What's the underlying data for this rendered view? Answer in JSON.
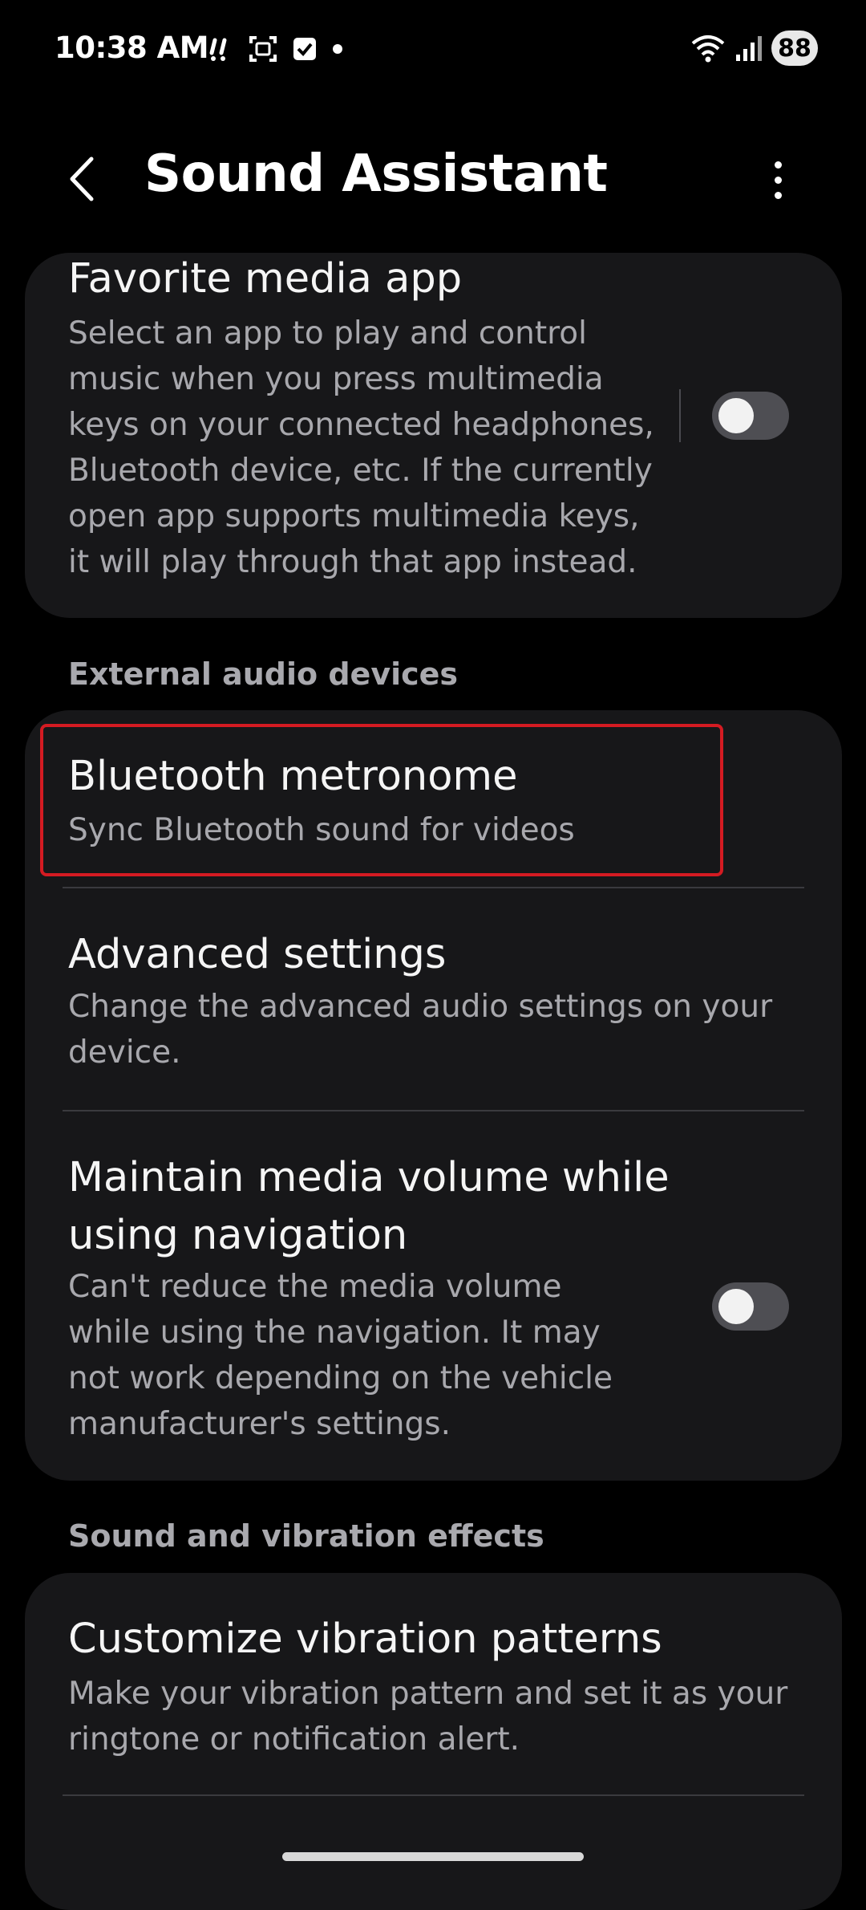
{
  "status_bar": {
    "time": "10:38 AM",
    "battery": "88",
    "icons": [
      "voicemail-icon",
      "screenshot-icon",
      "check-notification-icon",
      "dot-icon",
      "wifi-icon",
      "signal-icon",
      "battery-icon"
    ]
  },
  "app_bar": {
    "title": "Sound Assistant",
    "back_icon": "chevron-left-icon",
    "more_icon": "more-vert-icon"
  },
  "favorite_media": {
    "title": "Favorite media app",
    "description_lines": [
      "Select an app to play and control",
      "music when you press multimedia",
      "keys on your connected headphones,",
      "Bluetooth device, etc. If the currently",
      "open app supports multimedia keys,",
      "it will play through that app instead."
    ],
    "toggle_on": false
  },
  "sections": {
    "external_audio": "External audio devices",
    "sound_vibration": "Sound and vibration effects"
  },
  "external_audio_items": {
    "bluetooth_metronome": {
      "title": "Bluetooth metronome",
      "subtitle": "Sync Bluetooth sound for videos"
    },
    "advanced_settings": {
      "title": "Advanced settings",
      "subtitle_lines": [
        "Change the advanced audio settings on your",
        "device."
      ]
    },
    "maintain_volume": {
      "title_lines": [
        "Maintain media volume while",
        "using navigation"
      ],
      "subtitle_lines": [
        "Can't reduce the media volume",
        "while using the navigation. It may",
        "not work depending on the vehicle",
        "manufacturer's settings."
      ],
      "toggle_on": false
    }
  },
  "vibration_items": {
    "customize_patterns": {
      "title": "Customize vibration patterns",
      "subtitle_lines": [
        "Make your vibration pattern and set it as your",
        "ringtone or notification alert."
      ]
    }
  },
  "colors": {
    "background": "#000000",
    "card": "#171719",
    "highlight": "#d41b22",
    "toggle_off": "#4e4e53"
  }
}
